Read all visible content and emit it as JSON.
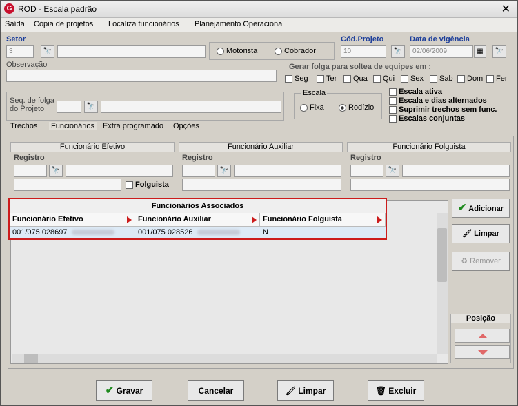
{
  "window": {
    "title": "ROD - Escala padrão",
    "app_icon": "G"
  },
  "menu": [
    "Saída",
    "Cópia de projetos",
    "Localiza funcionários",
    "Planejamento Operacional"
  ],
  "form": {
    "setor_label": "Setor",
    "setor_code": "3",
    "motorista_label": "Motorista",
    "cobrador_label": "Cobrador",
    "cod_projeto_label": "Cód.Projeto",
    "cod_projeto_value": "10",
    "data_vigencia_label": "Data de vigência",
    "data_vigencia_value": "02/06/2009",
    "observacao_label": "Observação",
    "gerar_folga_label": "Gerar folga para soltea de equipes em :",
    "days": [
      "Seg",
      "Ter",
      "Qua",
      "Qui",
      "Sex",
      "Sab",
      "Dom",
      "Fer"
    ],
    "seq_folga_label": "Seq. de folga\ndo Projeto",
    "escala_label": "Escala",
    "fixa_label": "Fixa",
    "rodizio_label": "Rodízio",
    "options": [
      "Escala ativa",
      "Escala e dias alternados",
      "Suprimir trechos sem func.",
      "Escalas conjuntas"
    ]
  },
  "tabs": [
    "Trechos",
    "Funcionários",
    "Extra programado",
    "Opções"
  ],
  "employee_panels": {
    "efetivo_title": "Funcionário Efetivo",
    "auxiliar_title": "Funcionário Auxiliar",
    "folguista_title": "Funcionário Folguista",
    "registro_label": "Registro",
    "folguista_check_label": "Folguista"
  },
  "grid": {
    "title": "Funcionários Associados",
    "headers": [
      "Funcionário Efetivo",
      "Funcionário Auxiliar",
      "Funcionário Folguista"
    ],
    "row": {
      "efetivo": "001/075 028697",
      "auxiliar": "001/075 028526",
      "folguista": "N"
    }
  },
  "side_buttons": {
    "adicionar": "Adicionar",
    "limpar": "Limpar",
    "remover": "Remover",
    "posicao": "Posição"
  },
  "bottom_buttons": {
    "gravar": "Gravar",
    "cancelar": "Cancelar",
    "limpar": "Limpar",
    "excluir": "Excluir"
  },
  "colors": {
    "highlight": "#cc1c1c",
    "label_blue": "#1e3f9a",
    "check_green": "#1f8a1f"
  }
}
